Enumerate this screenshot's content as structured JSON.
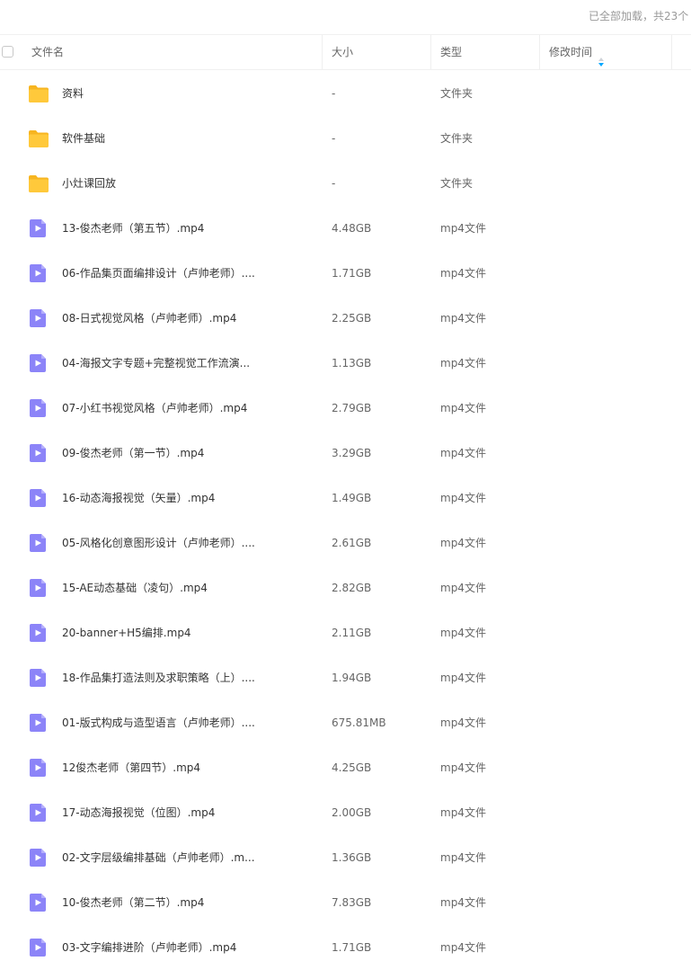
{
  "status_text": "已全部加载，共23个",
  "columns": {
    "name": "文件名",
    "size": "大小",
    "type": "类型",
    "modified": "修改时间"
  },
  "colors": {
    "folder": "#FFC93B",
    "video": "#8C84F8",
    "sort_arrow": "#06A7FF"
  },
  "files": [
    {
      "icon": "folder-icon",
      "name": "资料",
      "size": "-",
      "type": "文件夹"
    },
    {
      "icon": "folder-icon",
      "name": "软件基础",
      "size": "-",
      "type": "文件夹"
    },
    {
      "icon": "folder-icon",
      "name": "小灶课回放",
      "size": "-",
      "type": "文件夹"
    },
    {
      "icon": "video-file-icon",
      "name": "13-俊杰老师（第五节）.mp4",
      "size": "4.48GB",
      "type": "mp4文件"
    },
    {
      "icon": "video-file-icon",
      "name": "06-作品集页面编排设计（卢帅老师）....",
      "size": "1.71GB",
      "type": "mp4文件"
    },
    {
      "icon": "video-file-icon",
      "name": "08-日式视觉风格（卢帅老师）.mp4",
      "size": "2.25GB",
      "type": "mp4文件"
    },
    {
      "icon": "video-file-icon",
      "name": "04-海报文字专题+完整视觉工作流演...",
      "size": "1.13GB",
      "type": "mp4文件"
    },
    {
      "icon": "video-file-icon",
      "name": "07-小红书视觉风格（卢帅老师）.mp4",
      "size": "2.79GB",
      "type": "mp4文件"
    },
    {
      "icon": "video-file-icon",
      "name": "09-俊杰老师（第一节）.mp4",
      "size": "3.29GB",
      "type": "mp4文件"
    },
    {
      "icon": "video-file-icon",
      "name": "16-动态海报视觉（矢量）.mp4",
      "size": "1.49GB",
      "type": "mp4文件"
    },
    {
      "icon": "video-file-icon",
      "name": "05-风格化创意图形设计（卢帅老师）....",
      "size": "2.61GB",
      "type": "mp4文件"
    },
    {
      "icon": "video-file-icon",
      "name": "15-AE动态基础（凌句）.mp4",
      "size": "2.82GB",
      "type": "mp4文件"
    },
    {
      "icon": "video-file-icon",
      "name": "20-banner+H5编排.mp4",
      "size": "2.11GB",
      "type": "mp4文件"
    },
    {
      "icon": "video-file-icon",
      "name": "18-作品集打造法则及求职策略（上）....",
      "size": "1.94GB",
      "type": "mp4文件"
    },
    {
      "icon": "video-file-icon",
      "name": "01-版式构成与造型语言（卢帅老师）....",
      "size": "675.81MB",
      "type": "mp4文件"
    },
    {
      "icon": "video-file-icon",
      "name": "12俊杰老师（第四节）.mp4",
      "size": "4.25GB",
      "type": "mp4文件"
    },
    {
      "icon": "video-file-icon",
      "name": "17-动态海报视觉（位图）.mp4",
      "size": "2.00GB",
      "type": "mp4文件"
    },
    {
      "icon": "video-file-icon",
      "name": "02-文字层级编排基础（卢帅老师）.m...",
      "size": "1.36GB",
      "type": "mp4文件"
    },
    {
      "icon": "video-file-icon",
      "name": "10-俊杰老师（第二节）.mp4",
      "size": "7.83GB",
      "type": "mp4文件"
    },
    {
      "icon": "video-file-icon",
      "name": "03-文字编排进阶（卢帅老师）.mp4",
      "size": "1.71GB",
      "type": "mp4文件"
    }
  ]
}
